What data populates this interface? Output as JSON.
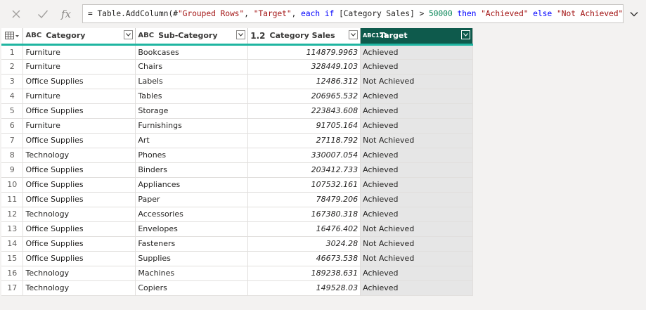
{
  "formula": {
    "prefix": "= Table.AddColumn(#",
    "str1": "\"Grouped Rows\"",
    "mid1": ", ",
    "str2": "\"Target\"",
    "mid2": ", ",
    "kw_each": "each",
    "mid3": " ",
    "kw_if": "if",
    "mid4": " [Category Sales] > ",
    "num": "50000",
    "mid5": " ",
    "kw_then": "then",
    "mid6": " ",
    "str3": "\"Achieved\"",
    "mid7": " ",
    "kw_else": "else",
    "mid8": " ",
    "str4": "\"Not Achieved\"",
    "suffix": ")",
    "fx_label": "fx"
  },
  "columns": [
    {
      "type": "ABC",
      "label": "Category"
    },
    {
      "type": "ABC",
      "label": "Sub-Category"
    },
    {
      "type": "1.2",
      "label": "Category Sales"
    },
    {
      "type": "ABC123",
      "label": "Target"
    }
  ],
  "icons": {
    "cancel": "close-icon",
    "commit": "checkmark-icon",
    "expand": "chevron-down-icon",
    "table": "table-icon"
  },
  "colors": {
    "header_accent": "#1fb5a1",
    "selected_header": "#0e5a4c"
  },
  "rows": [
    {
      "n": "1",
      "cat": "Furniture",
      "sub": "Bookcases",
      "sales": "114879.9963",
      "target": "Achieved"
    },
    {
      "n": "2",
      "cat": "Furniture",
      "sub": "Chairs",
      "sales": "328449.103",
      "target": "Achieved"
    },
    {
      "n": "3",
      "cat": "Office Supplies",
      "sub": "Labels",
      "sales": "12486.312",
      "target": "Not Achieved"
    },
    {
      "n": "4",
      "cat": "Furniture",
      "sub": "Tables",
      "sales": "206965.532",
      "target": "Achieved"
    },
    {
      "n": "5",
      "cat": "Office Supplies",
      "sub": "Storage",
      "sales": "223843.608",
      "target": "Achieved"
    },
    {
      "n": "6",
      "cat": "Furniture",
      "sub": "Furnishings",
      "sales": "91705.164",
      "target": "Achieved"
    },
    {
      "n": "7",
      "cat": "Office Supplies",
      "sub": "Art",
      "sales": "27118.792",
      "target": "Not Achieved"
    },
    {
      "n": "8",
      "cat": "Technology",
      "sub": "Phones",
      "sales": "330007.054",
      "target": "Achieved"
    },
    {
      "n": "9",
      "cat": "Office Supplies",
      "sub": "Binders",
      "sales": "203412.733",
      "target": "Achieved"
    },
    {
      "n": "10",
      "cat": "Office Supplies",
      "sub": "Appliances",
      "sales": "107532.161",
      "target": "Achieved"
    },
    {
      "n": "11",
      "cat": "Office Supplies",
      "sub": "Paper",
      "sales": "78479.206",
      "target": "Achieved"
    },
    {
      "n": "12",
      "cat": "Technology",
      "sub": "Accessories",
      "sales": "167380.318",
      "target": "Achieved"
    },
    {
      "n": "13",
      "cat": "Office Supplies",
      "sub": "Envelopes",
      "sales": "16476.402",
      "target": "Not Achieved"
    },
    {
      "n": "14",
      "cat": "Office Supplies",
      "sub": "Fasteners",
      "sales": "3024.28",
      "target": "Not Achieved"
    },
    {
      "n": "15",
      "cat": "Office Supplies",
      "sub": "Supplies",
      "sales": "46673.538",
      "target": "Not Achieved"
    },
    {
      "n": "16",
      "cat": "Technology",
      "sub": "Machines",
      "sales": "189238.631",
      "target": "Achieved"
    },
    {
      "n": "17",
      "cat": "Technology",
      "sub": "Copiers",
      "sales": "149528.03",
      "target": "Achieved"
    }
  ]
}
